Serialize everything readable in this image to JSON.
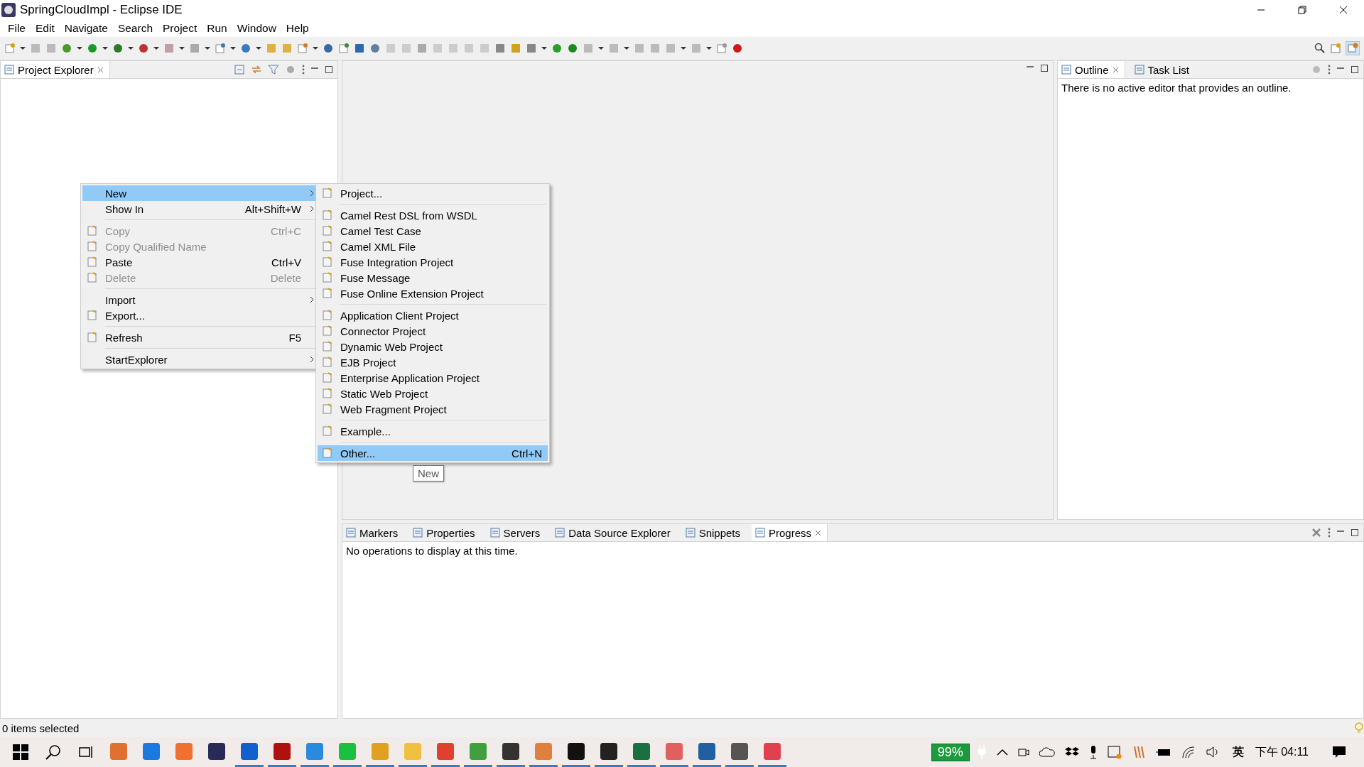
{
  "window": {
    "title": "SpringCloudImpl - Eclipse IDE"
  },
  "menu_bar": [
    "File",
    "Edit",
    "Navigate",
    "Search",
    "Project",
    "Run",
    "Window",
    "Help"
  ],
  "project_explorer": {
    "tabs": [
      {
        "label": "Project Explorer",
        "selected": true
      }
    ]
  },
  "context_menu": [
    {
      "kind": "item",
      "label": "New",
      "selected": true,
      "submenu": true,
      "disabled": false,
      "has_icon": false
    },
    {
      "kind": "item",
      "label": "Show In",
      "shortcut": "Alt+Shift+W",
      "submenu": true,
      "selected": false,
      "disabled": false,
      "has_icon": false
    },
    {
      "kind": "separator"
    },
    {
      "kind": "item",
      "label": "Copy",
      "shortcut": "Ctrl+C",
      "disabled": true,
      "selected": false,
      "submenu": false,
      "has_icon": true
    },
    {
      "kind": "item",
      "label": "Copy Qualified Name",
      "disabled": true,
      "selected": false,
      "submenu": false,
      "has_icon": true
    },
    {
      "kind": "item",
      "label": "Paste",
      "shortcut": "Ctrl+V",
      "disabled": false,
      "selected": false,
      "submenu": false,
      "has_icon": true
    },
    {
      "kind": "item",
      "label": "Delete",
      "shortcut": "Delete",
      "disabled": true,
      "selected": false,
      "submenu": false,
      "has_icon": true
    },
    {
      "kind": "separator"
    },
    {
      "kind": "item",
      "label": "Import",
      "submenu": true,
      "disabled": false,
      "selected": false,
      "has_icon": false
    },
    {
      "kind": "item",
      "label": "Export...",
      "disabled": false,
      "selected": false,
      "submenu": false,
      "has_icon": true
    },
    {
      "kind": "separator"
    },
    {
      "kind": "item",
      "label": "Refresh",
      "shortcut": "F5",
      "disabled": false,
      "selected": false,
      "submenu": false,
      "has_icon": true
    },
    {
      "kind": "separator"
    },
    {
      "kind": "item",
      "label": "StartExplorer",
      "submenu": true,
      "disabled": false,
      "selected": false,
      "has_icon": false
    }
  ],
  "new_submenu": [
    {
      "kind": "item",
      "label": "Project...",
      "selected": false
    },
    {
      "kind": "separator"
    },
    {
      "kind": "item",
      "label": "Camel Rest DSL from WSDL",
      "selected": false
    },
    {
      "kind": "item",
      "label": "Camel Test Case",
      "selected": false
    },
    {
      "kind": "item",
      "label": "Camel XML File",
      "selected": false
    },
    {
      "kind": "item",
      "label": "Fuse Integration Project",
      "selected": false
    },
    {
      "kind": "item",
      "label": "Fuse Message",
      "selected": false
    },
    {
      "kind": "item",
      "label": "Fuse Online Extension Project",
      "selected": false
    },
    {
      "kind": "separator"
    },
    {
      "kind": "item",
      "label": "Application Client Project",
      "selected": false
    },
    {
      "kind": "item",
      "label": "Connector Project",
      "selected": false
    },
    {
      "kind": "item",
      "label": "Dynamic Web Project",
      "selected": false
    },
    {
      "kind": "item",
      "label": "EJB Project",
      "selected": false
    },
    {
      "kind": "item",
      "label": "Enterprise Application Project",
      "selected": false
    },
    {
      "kind": "item",
      "label": "Static Web Project",
      "selected": false
    },
    {
      "kind": "item",
      "label": "Web Fragment Project",
      "selected": false
    },
    {
      "kind": "separator"
    },
    {
      "kind": "item",
      "label": "Example...",
      "selected": false
    },
    {
      "kind": "separator"
    },
    {
      "kind": "item",
      "label": "Other...",
      "shortcut": "Ctrl+N",
      "selected": true
    }
  ],
  "tooltip": "New",
  "outline_panel": {
    "tabs": [
      {
        "label": "Outline",
        "selected": true
      },
      {
        "label": "Task List",
        "selected": false
      }
    ],
    "message": "There is no active editor that provides an outline."
  },
  "bottom_panel": {
    "tabs": [
      {
        "label": "Markers",
        "selected": false
      },
      {
        "label": "Properties",
        "selected": false
      },
      {
        "label": "Servers",
        "selected": false
      },
      {
        "label": "Data Source Explorer",
        "selected": false
      },
      {
        "label": "Snippets",
        "selected": false
      },
      {
        "label": "Progress",
        "selected": true
      }
    ],
    "message": "No operations to display at this time."
  },
  "status_bar": {
    "text": "0 items selected"
  },
  "taskbar": {
    "apps": [
      {
        "running": false
      },
      {
        "running": false
      },
      {
        "running": false
      },
      {
        "running": false
      },
      {
        "running": true
      },
      {
        "running": true
      },
      {
        "running": true
      },
      {
        "running": true
      },
      {
        "running": true
      },
      {
        "running": true
      },
      {
        "running": true
      },
      {
        "running": true
      },
      {
        "running": true
      },
      {
        "running": true
      },
      {
        "running": true
      },
      {
        "running": true
      },
      {
        "running": true
      },
      {
        "running": true
      },
      {
        "running": true
      },
      {
        "running": true
      },
      {
        "running": true
      }
    ],
    "battery": "99%",
    "input_method": "英",
    "clock": "下午 04:11"
  }
}
